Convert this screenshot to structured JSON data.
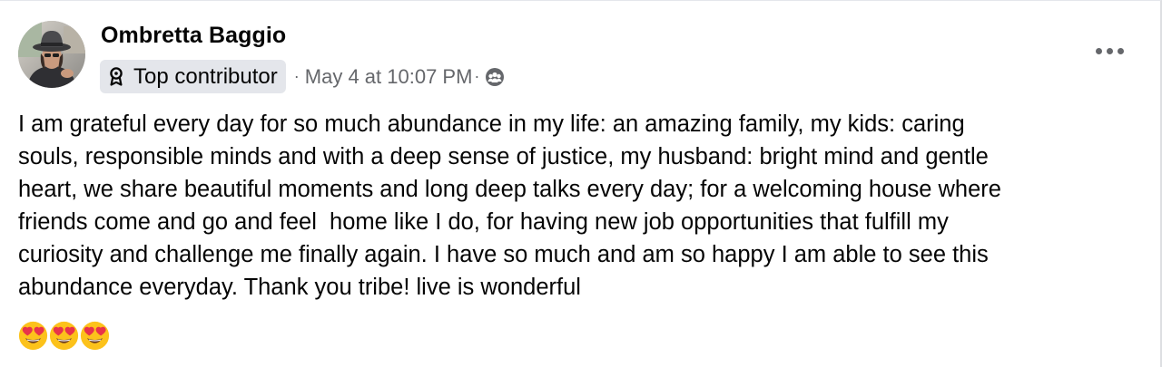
{
  "post": {
    "author": {
      "name": "Ombretta Baggio",
      "avatar_icon": "profile-photo"
    },
    "badge": {
      "label": "Top contributor",
      "icon": "award-ribbon-icon"
    },
    "meta": {
      "separator": "·",
      "timestamp": "May 4 at 10:07 PM",
      "dot": "·",
      "audience_icon": "group-members-icon"
    },
    "body": "I am grateful every day for so much abundance in my life: an amazing family, my kids: caring\nsouls, responsible minds and with a deep sense of justice, my husband: bright mind and gentle\nheart, we share beautiful moments and long deep talks every day; for a welcoming house where\nfriends come and go and feel  home like I do, for having new job opportunities that fulfill my\ncuriosity and challenge me finally again. I have so much and am so happy I am able to see this\nabundance everyday. Thank you tribe! live is wonderful",
    "emojis": [
      "heart-eyes-emoji",
      "heart-eyes-emoji",
      "heart-eyes-emoji"
    ],
    "more_options_icon": "more-horizontal-icon"
  },
  "colors": {
    "primary_text": "#050505",
    "secondary_text": "#65676b",
    "badge_background": "#e4e6eb",
    "emoji_face": "#fcc21b",
    "emoji_heart": "#e8334a"
  }
}
